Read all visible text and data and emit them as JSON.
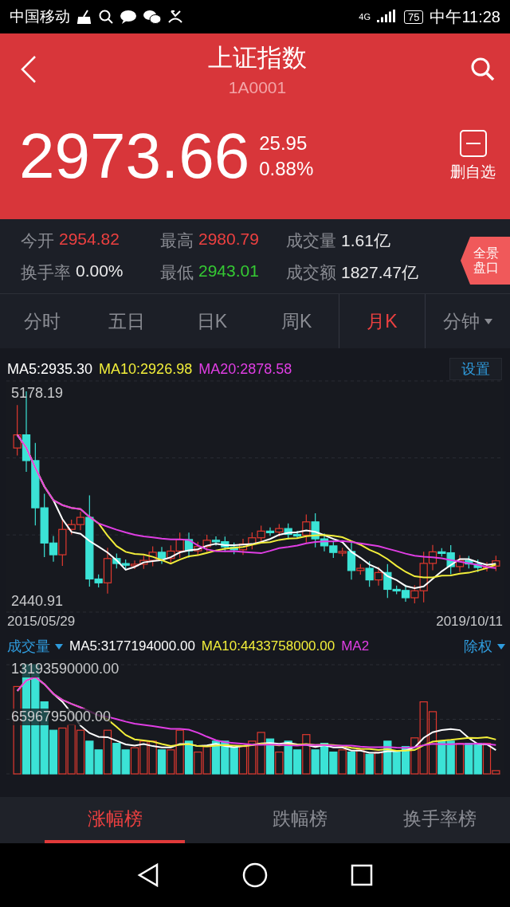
{
  "status_bar": {
    "carrier": "中国移动",
    "network": "4G",
    "battery": "75",
    "time": "中午11:28"
  },
  "header": {
    "title": "上证指数",
    "code": "1A0001"
  },
  "quote": {
    "price": "2973.66",
    "change": "25.95",
    "change_pct": "0.88%",
    "watchlist_button": "删自选"
  },
  "stats": [
    {
      "label": "今开",
      "value": "2954.82",
      "color": "#ec4040"
    },
    {
      "label": "最高",
      "value": "2980.79",
      "color": "#ec4040"
    },
    {
      "label": "成交量",
      "value": "1.61亿",
      "color": "#e9e9ea"
    },
    {
      "label": "换手率",
      "value": "0.00%",
      "color": "#e9e9ea"
    },
    {
      "label": "最低",
      "value": "2943.01",
      "color": "#35c933"
    },
    {
      "label": "成交额",
      "value": "1827.47亿",
      "color": "#e9e9ea"
    }
  ],
  "panorama_button": "全景盘口",
  "period_tabs": [
    {
      "label": "分时",
      "selected": false,
      "dropdown": false
    },
    {
      "label": "五日",
      "selected": false,
      "dropdown": false
    },
    {
      "label": "日K",
      "selected": false,
      "dropdown": false
    },
    {
      "label": "周K",
      "selected": false,
      "dropdown": false
    },
    {
      "label": "月K",
      "selected": true,
      "dropdown": false
    },
    {
      "label": "分钟",
      "selected": false,
      "dropdown": true
    }
  ],
  "kline": {
    "ma_labels": [
      {
        "text": "MA5:2935.30",
        "color": "#ffffff"
      },
      {
        "text": "MA10:2926.98",
        "color": "#f2ee3a"
      },
      {
        "text": "MA20:2878.58",
        "color": "#e03ee4"
      }
    ],
    "settings_button": "设置",
    "max_label": "5178.19",
    "min_label": "2440.91",
    "start_date": "2015/05/29",
    "end_date": "2019/10/11"
  },
  "volume": {
    "indicator": "成交量",
    "ma_labels": [
      {
        "text": "MA5:3177194000.00",
        "color": "#ffffff"
      },
      {
        "text": "MA10:4433758000.00",
        "color": "#f2ee3a"
      },
      {
        "text": "MA2",
        "color": "#e03ee4"
      }
    ],
    "adjust_button": "除权",
    "max_label": "13193590000.00",
    "mid_label": "6596795000.00"
  },
  "ranking_tabs": [
    {
      "label": "涨幅榜",
      "selected": true
    },
    {
      "label": "跌幅榜",
      "selected": false
    },
    {
      "label": "换手率榜",
      "selected": false
    }
  ]
}
